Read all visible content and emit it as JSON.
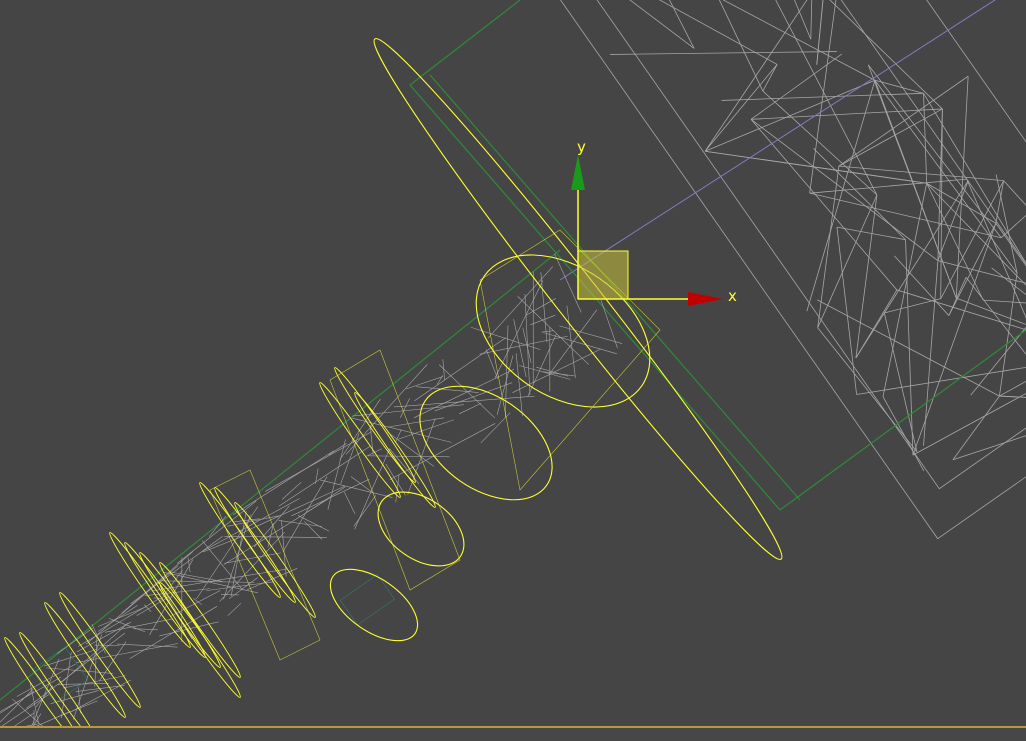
{
  "viewport": {
    "background": "#454545",
    "selection_color": "#ffff33",
    "wire_color": "#b8b8b8",
    "group_color": "#2f8a3a",
    "teal_color": "#2e8c7a"
  },
  "gizmo": {
    "x_label": "x",
    "y_label": "y",
    "x_color": "#c00000",
    "y_color": "#1a9a1a",
    "plane_color": "#c9c23a"
  },
  "objects": {
    "fuselage": "airplane-fuselage-wireframe",
    "wing": "selected-wing-ellipse",
    "engine_rings": "selected-engine-rings"
  }
}
